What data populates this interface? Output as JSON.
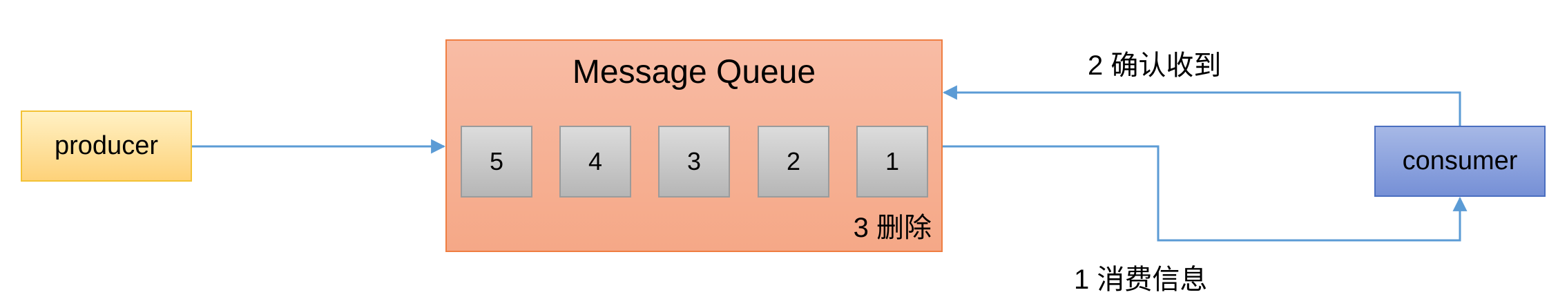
{
  "nodes": {
    "producer": "producer",
    "queue_title": "Message Queue",
    "messages": [
      "5",
      "4",
      "3",
      "2",
      "1"
    ],
    "delete_label": "3 删除",
    "consumer": "consumer"
  },
  "edges": {
    "ack_label": "2 确认收到",
    "consume_label": "1 消费信息"
  },
  "colors": {
    "arrow": "#5b9bd5"
  }
}
